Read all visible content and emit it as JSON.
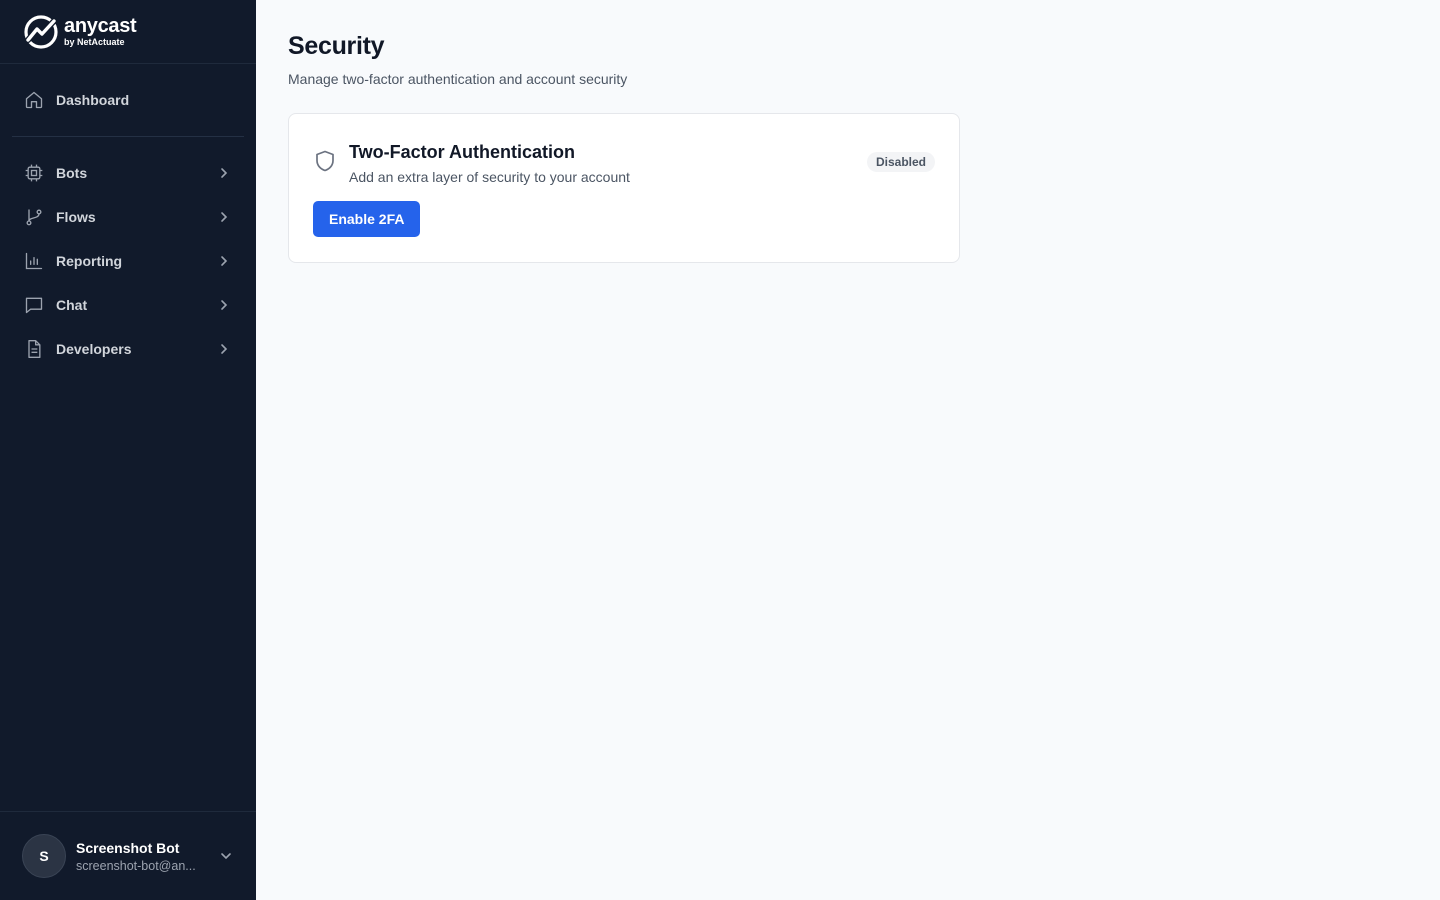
{
  "brand": {
    "name": "anycast",
    "sub": "by NetActuate",
    "color": "#ffffff"
  },
  "sidebar": {
    "items": [
      {
        "label": "Dashboard",
        "icon": "home-icon"
      },
      {
        "label": "Bots",
        "icon": "cpu-icon"
      },
      {
        "label": "Flows",
        "icon": "git-branch-icon"
      },
      {
        "label": "Reporting",
        "icon": "bar-chart-icon"
      },
      {
        "label": "Chat",
        "icon": "message-square-icon"
      },
      {
        "label": "Developers",
        "icon": "file-text-icon"
      }
    ]
  },
  "user": {
    "initial": "S",
    "name": "Screenshot Bot",
    "email": "screenshot-bot@an..."
  },
  "page": {
    "title": "Security",
    "subtitle": "Manage two-factor authentication and account security"
  },
  "twofa": {
    "title": "Two-Factor Authentication",
    "description": "Add an extra layer of security to your account",
    "status": "Disabled",
    "button_label": "Enable 2FA"
  },
  "colors": {
    "sidebar_bg": "#111a2b",
    "accent": "#2563eb",
    "page_bg": "#f8fafc"
  }
}
